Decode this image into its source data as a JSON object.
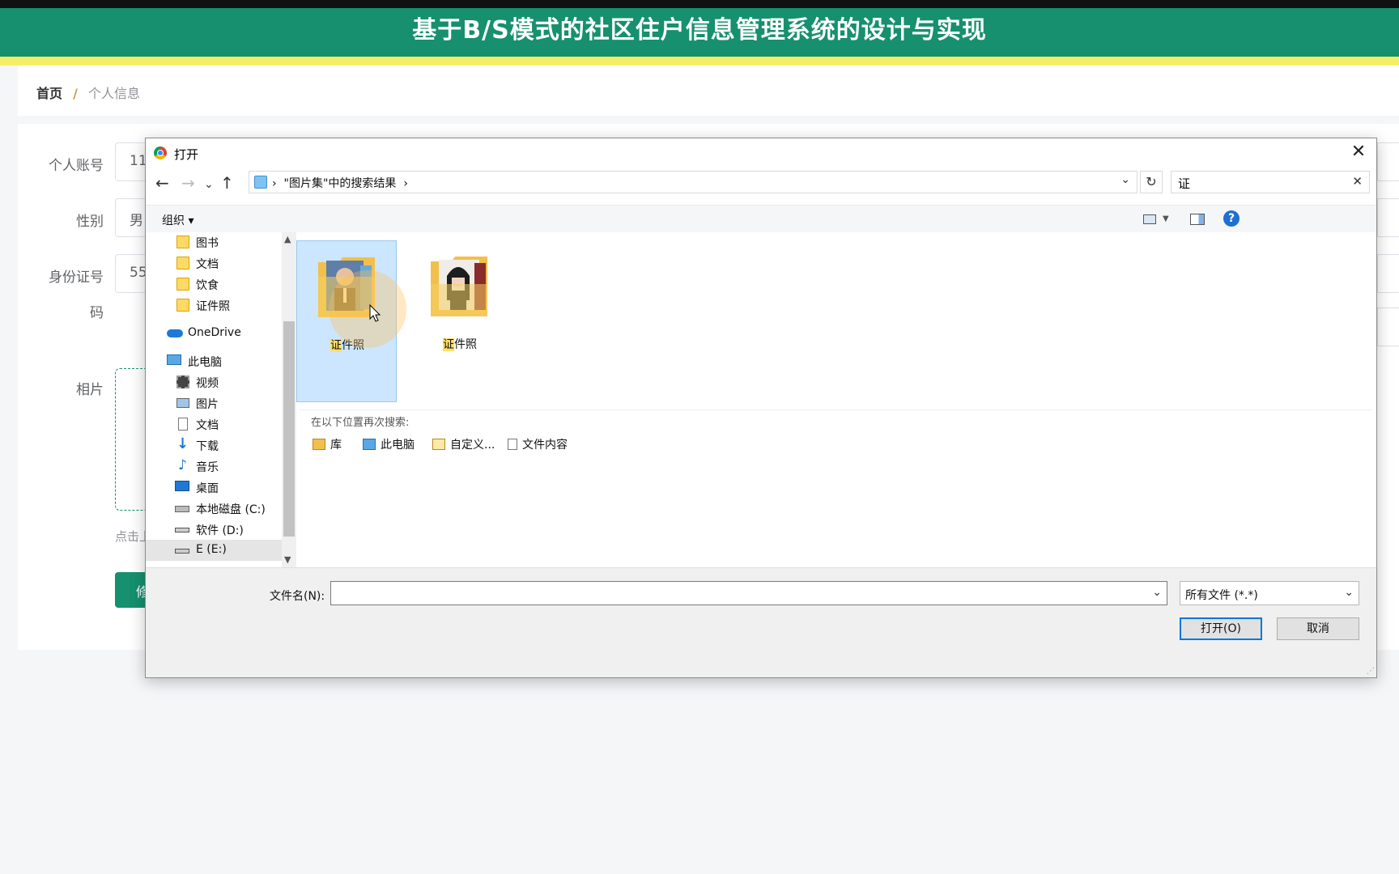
{
  "page": {
    "title": "基于B/S模式的社区住户信息管理系统的设计与实现",
    "breadcrumb": {
      "home": "首页",
      "separator": "/",
      "current": "个人信息"
    },
    "form": {
      "account_label": "个人账号",
      "account_value": "11",
      "gender_label": "性别",
      "gender_value": "男",
      "id_label_line1": "身份证号",
      "id_label_line2": "码",
      "id_value": "55",
      "photo_label": "相片",
      "upload_hint": "点击上",
      "save_label": "修"
    },
    "colors": {
      "header": "#16906f",
      "accent_bar": "#f6ef66",
      "primary_button": "#16906f"
    }
  },
  "dialog": {
    "title": "打开",
    "close_glyph": "✕",
    "nav": {
      "back": "←",
      "forward": "→",
      "recent": "⌄",
      "up": "↑"
    },
    "address": {
      "separator": "›",
      "path": "\"图片集\"中的搜索结果",
      "trailing": "›"
    },
    "search_value": "证",
    "organize_label": "组织 ▾",
    "nav_pane": {
      "folders": [
        "图书",
        "文档",
        "饮食",
        "证件照"
      ],
      "onedrive": "OneDrive",
      "this_pc": "此电脑",
      "pc_items": [
        "视频",
        "图片",
        "文档",
        "下载",
        "音乐",
        "桌面",
        "本地磁盘 (C:)",
        "软件 (D:)",
        "E (E:)"
      ]
    },
    "results": [
      {
        "highlight": "证",
        "rest": "件照"
      },
      {
        "highlight": "证",
        "rest": "件照"
      }
    ],
    "search_again_label": "在以下位置再次搜索:",
    "search_again_locations": [
      "库",
      "此电脑",
      "自定义...",
      "文件内容"
    ],
    "filename_label": "文件名(N):",
    "filename_value": "",
    "filetype_value": "所有文件 (*.*)",
    "open_button": "打开(O)",
    "cancel_button": "取消"
  }
}
